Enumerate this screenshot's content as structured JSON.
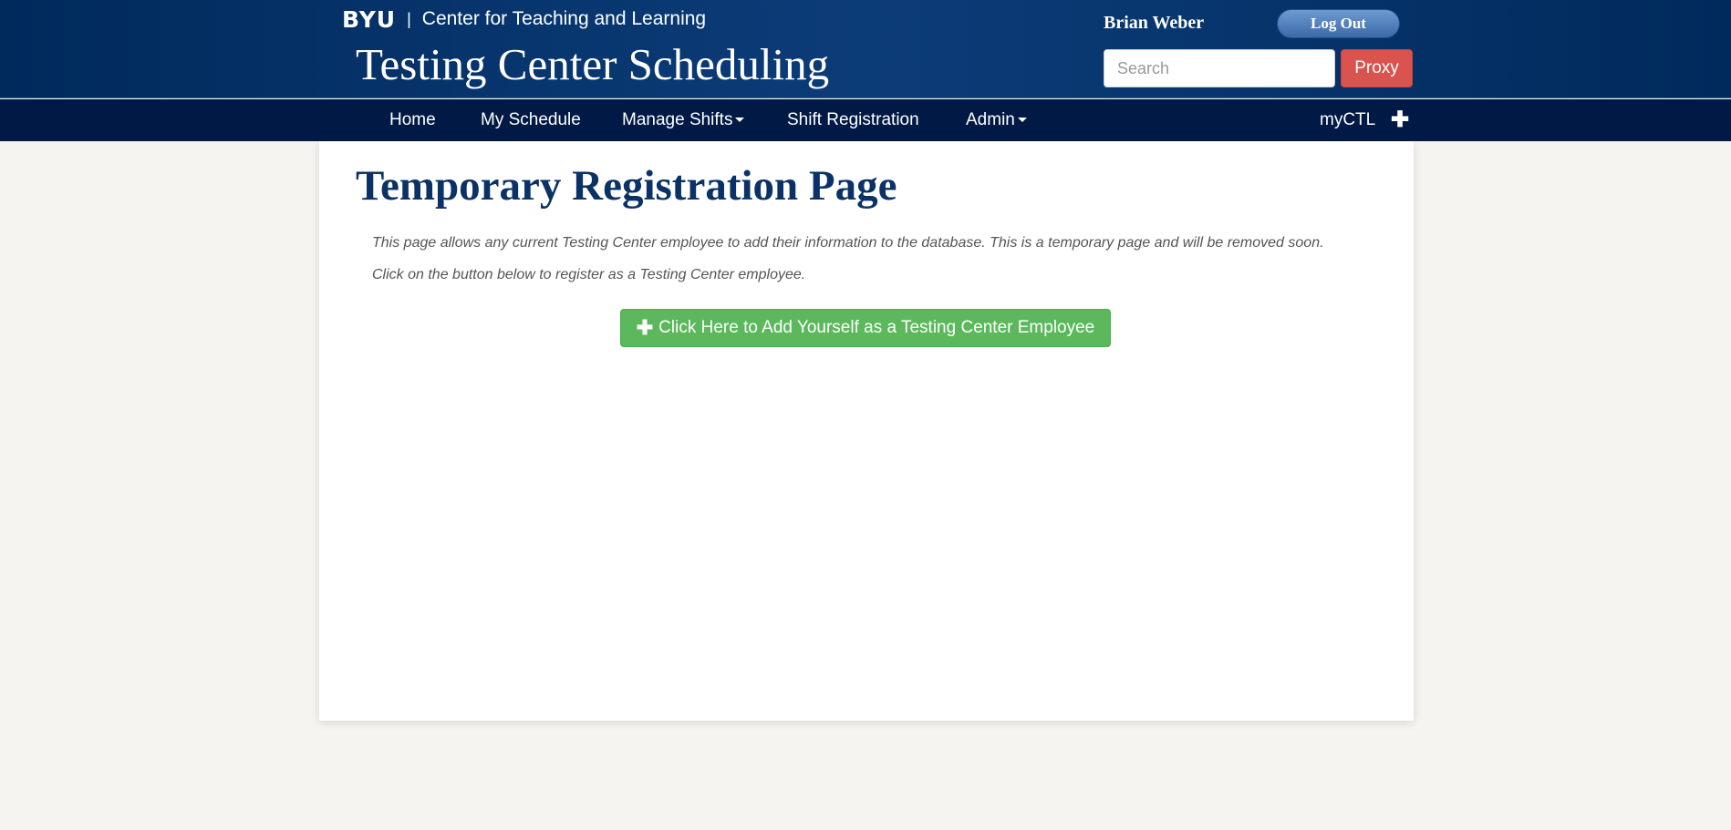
{
  "header": {
    "logo": "BYU",
    "separator": "|",
    "department": "Center for Teaching and Learning",
    "site_title": "Testing Center Scheduling",
    "user_name": "Brian Weber",
    "logout_label": "Log Out",
    "search_placeholder": "Search",
    "proxy_label": "Proxy"
  },
  "nav": {
    "items": [
      {
        "label": "Home"
      },
      {
        "label": "My Schedule"
      },
      {
        "label": "Manage Shifts"
      },
      {
        "label": "Shift Registration"
      },
      {
        "label": "Admin"
      }
    ],
    "myctl_label": "myCTL",
    "plus_icon": "plus-icon"
  },
  "main": {
    "title": "Temporary Registration Page",
    "description_1": "This page allows any current Testing Center employee to add their information to the database. This is a temporary page and will be removed soon.",
    "description_2": "Click on the button below to register as a Testing Center employee.",
    "add_button_label": "Click Here to Add Yourself as a Testing Center Employee",
    "add_button_icon": "plus-icon"
  },
  "colors": {
    "header_bg": "#002a5c",
    "nav_bg": "#001a45",
    "title_color": "#0b3266",
    "proxy": "#d9534f",
    "add_button": "#5cb85c"
  }
}
